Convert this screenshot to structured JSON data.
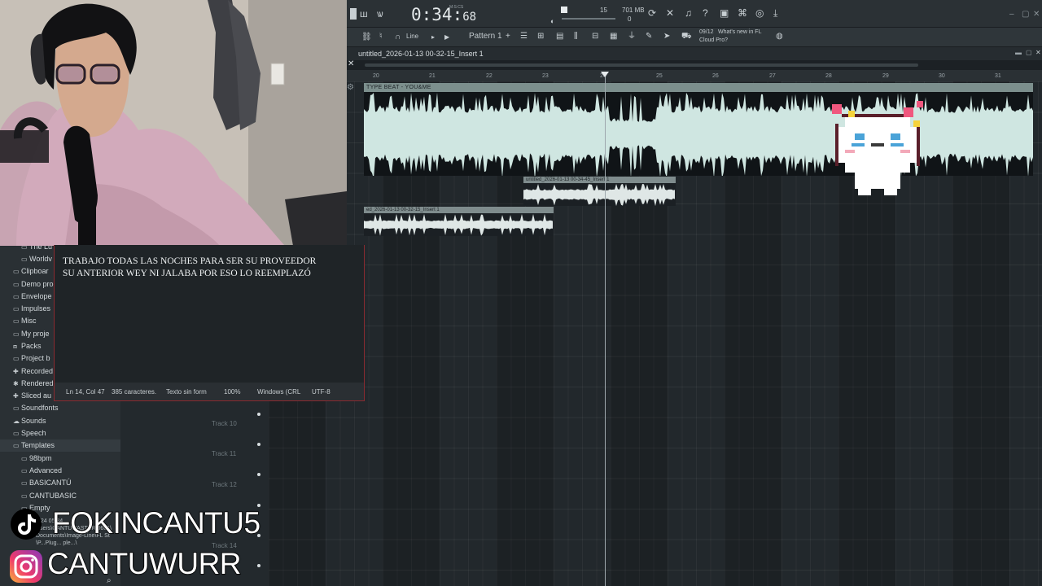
{
  "toolbar": {
    "time": "0:34:",
    "time_frac": "68",
    "time_label": "M:S:CS",
    "tempo": "15",
    "memory_mb": "701 MB",
    "memory_sub": "0",
    "snap_label": "Line",
    "pattern_label": "Pattern 1",
    "news_date": "09/12",
    "news_text_1": "What's new in FL",
    "news_text_2": "Cloud Pro?"
  },
  "playlist": {
    "window_title": "untitled_2026-01-13 00-32-15_Insert 1",
    "ruler": [
      "20",
      "21",
      "22",
      "23",
      "24",
      "25",
      "26",
      "27",
      "28",
      "29",
      "30",
      "31"
    ],
    "main_clip_label": "TYPE BEAT - YOU&ME",
    "clip_a_label": "untitled_2026-01-13 00-34-45_Insert 1",
    "clip_b_label": "ed_2026-01-13 00-32-15_Insert 1",
    "tracks": [
      "Track 10",
      "Track 11",
      "Track 12",
      "Track 14"
    ]
  },
  "browser": {
    "items": [
      {
        "icon": "folder-icon",
        "label": "The Lu"
      },
      {
        "icon": "folder-icon",
        "label": "Worldv"
      },
      {
        "icon": "folder-icon",
        "label": "Clipboar"
      },
      {
        "icon": "folder-icon",
        "label": "Demo pro"
      },
      {
        "icon": "folder-icon",
        "label": "Envelope"
      },
      {
        "icon": "folder-icon",
        "label": "Impulses"
      },
      {
        "icon": "folder-icon",
        "label": "Misc"
      },
      {
        "icon": "folder-icon",
        "label": "My proje"
      },
      {
        "icon": "packs-icon",
        "label": "Packs"
      },
      {
        "icon": "folder-icon",
        "label": "Project b"
      },
      {
        "icon": "plus-icon",
        "label": "Recorded"
      },
      {
        "icon": "render-icon",
        "label": "Rendered"
      },
      {
        "icon": "plus-icon",
        "label": "Sliced au"
      },
      {
        "icon": "folder-icon",
        "label": "Soundfonts"
      },
      {
        "icon": "cloud-icon",
        "label": "Sounds"
      },
      {
        "icon": "folder-icon",
        "label": "Speech"
      },
      {
        "icon": "folder-icon",
        "label": "Templates"
      },
      {
        "icon": "folder-icon",
        "label": "98bpm"
      },
      {
        "icon": "folder-icon",
        "label": "Advanced"
      },
      {
        "icon": "folder-icon",
        "label": "BASICANTÚ"
      },
      {
        "icon": "folder-icon",
        "label": "CANTUBASIC"
      },
      {
        "icon": "folder-icon",
        "label": "Empty"
      }
    ],
    "path_lines": [
      "6/24 05 34",
      "Users\\CANTUMASTER\\0661\\",
      "Documents\\Image-Line\\FL St",
      "\\P...Plug... ple...\\"
    ]
  },
  "notepad": {
    "line1": "TRABAJO TODAS LAS NOCHES PARA SER SU PROVEEDOR",
    "line2": "SU ANTERIOR WEY NI JALABA POR ESO LO REEMPLAZÓ",
    "status": {
      "position": "Ln 14, Col 47",
      "chars": "385 caracteres.",
      "format": "Texto sin form",
      "zoom": "100%",
      "eol": "Windows (CRL",
      "encoding": "UTF-8"
    }
  },
  "overlay": {
    "tiktok": "FOKINCANTU5",
    "instagram": "CANTUWURR"
  }
}
